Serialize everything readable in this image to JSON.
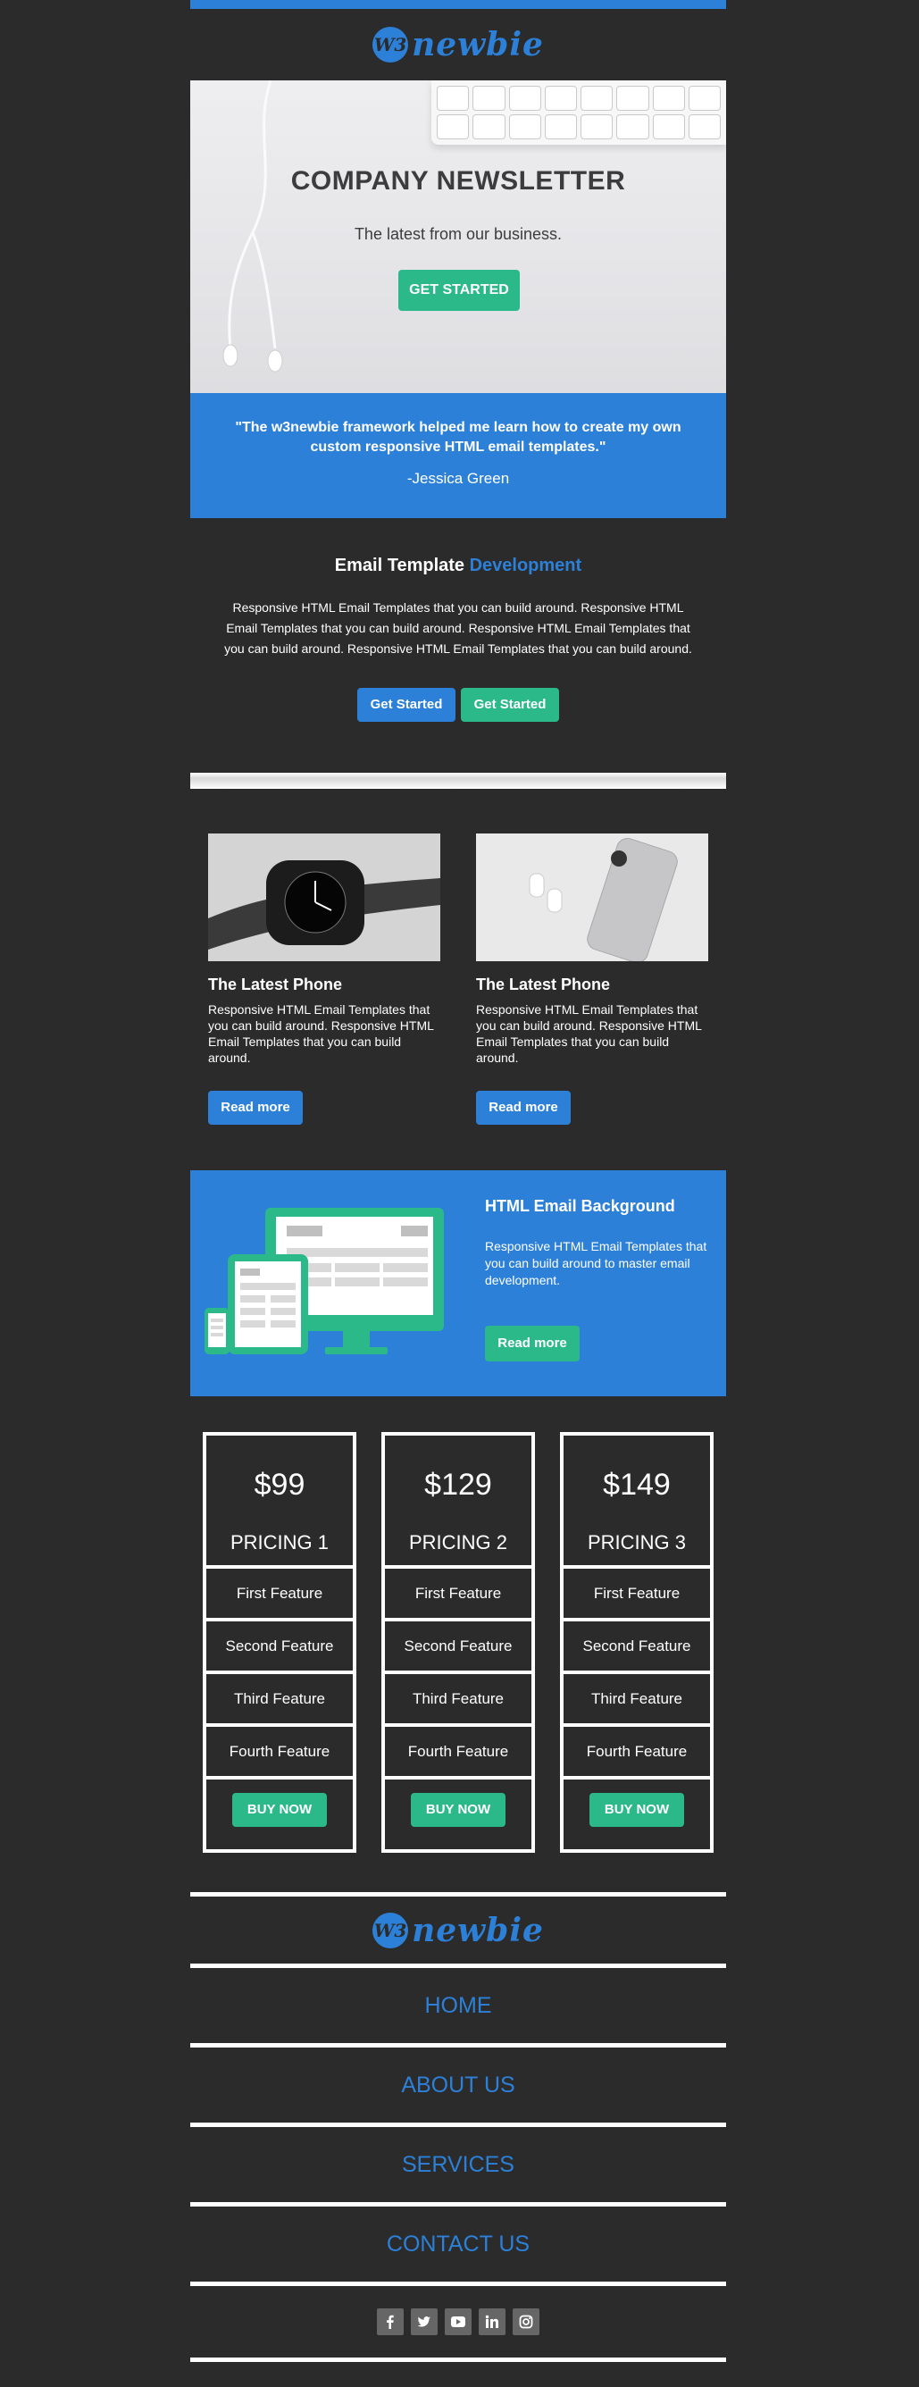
{
  "brand": {
    "logo_mark": "W3",
    "logo_word": "newbie",
    "accent": "#2c80d8",
    "green": "#2cb98a"
  },
  "hero": {
    "title": "COMPANY NEWSLETTER",
    "subtitle": "The latest from our business.",
    "cta": "GET STARTED"
  },
  "quote": {
    "text": "\"The w3newbie framework helped me learn how to create my own custom responsive HTML email templates.\"",
    "author": "-Jessica Green"
  },
  "intro": {
    "title_main": "Email Template",
    "title_accent": "Development",
    "body": "Responsive HTML Email Templates that you can build around. Responsive HTML Email Templates that you can build around. Responsive HTML Email Templates that you can build around. Responsive HTML Email Templates that you can build around.",
    "button_blue": "Get Started",
    "button_green": "Get Started"
  },
  "products": [
    {
      "title": "The Latest Phone",
      "text": "Responsive HTML Email Templates that you can build around. Responsive HTML Email Templates that you can build around.",
      "button": "Read more",
      "image": "smartwatch-photo"
    },
    {
      "title": "The Latest Phone",
      "text": "Responsive HTML Email Templates that you can build around. Responsive HTML Email Templates that you can build around.",
      "button": "Read more",
      "image": "phone-earbuds-photo"
    }
  ],
  "feature": {
    "title": "HTML Email Background",
    "text": "Responsive HTML Email Templates that you can build around to master email development.",
    "button": "Read more"
  },
  "pricing": [
    {
      "price": "$99",
      "name": "PRICING 1",
      "features": [
        "First Feature",
        "Second Feature",
        "Third Feature",
        "Fourth Feature"
      ],
      "button": "BUY NOW"
    },
    {
      "price": "$129",
      "name": "PRICING 2",
      "features": [
        "First Feature",
        "Second Feature",
        "Third Feature",
        "Fourth Feature"
      ],
      "button": "BUY NOW"
    },
    {
      "price": "$149",
      "name": "PRICING 3",
      "features": [
        "First Feature",
        "Second Feature",
        "Third Feature",
        "Fourth Feature"
      ],
      "button": "BUY NOW"
    }
  ],
  "footer": {
    "nav": [
      "HOME",
      "ABOUT US",
      "SERVICES",
      "CONTACT US"
    ],
    "social": [
      "facebook-icon",
      "twitter-icon",
      "youtube-icon",
      "linkedin-icon",
      "instagram-icon"
    ]
  }
}
